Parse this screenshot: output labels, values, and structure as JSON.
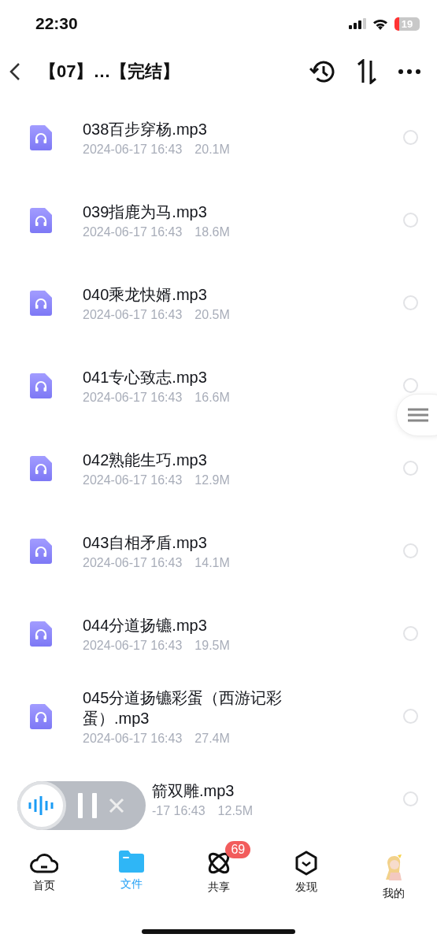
{
  "status_bar": {
    "time": "22:30",
    "battery": "19"
  },
  "header": {
    "title": "【07】…【完结】"
  },
  "files": [
    {
      "kind": "file",
      "name": "038百步穿杨.mp3",
      "date": "2024-06-17 16:43",
      "size": "20.1M",
      "selected": false
    },
    {
      "kind": "file",
      "name": "039指鹿为马.mp3",
      "date": "2024-06-17 16:43",
      "size": "18.6M",
      "selected": false
    },
    {
      "kind": "file",
      "name": "040乘龙快婿.mp3",
      "date": "2024-06-17 16:43",
      "size": "20.5M",
      "selected": false
    },
    {
      "kind": "file",
      "name": "041专心致志.mp3",
      "date": "2024-06-17 16:43",
      "size": "16.6M",
      "selected": false
    },
    {
      "kind": "file",
      "name": "042熟能生巧.mp3",
      "date": "2024-06-17 16:43",
      "size": "12.9M",
      "selected": false
    },
    {
      "kind": "file",
      "name": "043自相矛盾.mp3",
      "date": "2024-06-17 16:43",
      "size": "14.1M",
      "selected": false
    },
    {
      "kind": "file",
      "name": "044分道扬镳.mp3",
      "date": "2024-06-17 16:43",
      "size": "19.5M",
      "selected": false
    },
    {
      "kind": "file",
      "name": "045分道扬镳彩蛋（西游记彩蛋）.mp3",
      "date": "2024-06-17 16:43",
      "size": "27.4M",
      "selected": false
    },
    {
      "kind": "covered",
      "name": "箭双雕.mp3",
      "date": "-17 16:43",
      "size": "12.5M",
      "selected": false
    }
  ],
  "nav": [
    {
      "label": "首页",
      "kind": "cloud",
      "selected": false
    },
    {
      "label": "文件",
      "kind": "folder",
      "selected": true
    },
    {
      "label": "共享",
      "kind": "orbit",
      "selected": false,
      "badge": "69"
    },
    {
      "label": "发现",
      "kind": "box",
      "selected": false
    },
    {
      "label": "我的",
      "kind": "avatar",
      "selected": false
    }
  ]
}
